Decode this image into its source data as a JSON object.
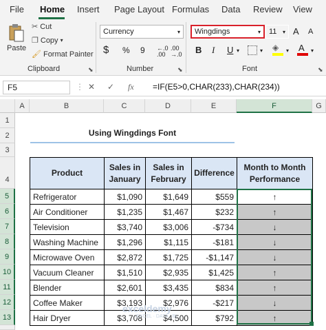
{
  "ribbon_tabs": [
    "File",
    "Home",
    "Insert",
    "Page Layout",
    "Formulas",
    "Data",
    "Review",
    "View"
  ],
  "clipboard": {
    "paste": "Paste",
    "cut": "Cut",
    "copy": "Copy",
    "format_painter": "Format Painter",
    "label": "Clipboard"
  },
  "number": {
    "format": "Currency",
    "currency_symbol": "$",
    "percent": "%",
    "comma": "9",
    "inc_decimal": "←.0 .00",
    "dec_decimal": ".00 →.0",
    "label": "Number"
  },
  "font": {
    "name": "Wingdings",
    "size": "11",
    "grow": "A",
    "shrink": "A",
    "bold": "B",
    "italic": "I",
    "underline": "U",
    "label": "Font"
  },
  "formula_bar": {
    "name_box": "F5",
    "cancel": "✕",
    "enter": "✓",
    "fx": "fx",
    "formula": "=IF(E5>0,CHAR(233),CHAR(234))"
  },
  "columns": [
    "A",
    "B",
    "C",
    "D",
    "E",
    "F",
    "G"
  ],
  "rows": [
    "1",
    "2",
    "3",
    "4",
    "5",
    "6",
    "7",
    "8",
    "9",
    "10",
    "11",
    "12",
    "13"
  ],
  "sheet": {
    "title": "Using Wingdings Font",
    "headers": [
      "Product",
      "Sales in January",
      "Sales in February",
      "Difference",
      "Month to Month Performance"
    ],
    "data": [
      {
        "product": "Refrigerator",
        "jan": "$1,090",
        "feb": "$1,649",
        "diff": "$559",
        "perf": "↑"
      },
      {
        "product": "Air Conditioner",
        "jan": "$1,235",
        "feb": "$1,467",
        "diff": "$232",
        "perf": "↑"
      },
      {
        "product": "Television",
        "jan": "$3,740",
        "feb": "$3,006",
        "diff": "-$734",
        "perf": "↓"
      },
      {
        "product": "Washing Machine",
        "jan": "$1,296",
        "feb": "$1,115",
        "diff": "-$181",
        "perf": "↓"
      },
      {
        "product": "Microwave Oven",
        "jan": "$2,872",
        "feb": "$1,725",
        "diff": "-$1,147",
        "perf": "↓"
      },
      {
        "product": "Vacuum Cleaner",
        "jan": "$1,510",
        "feb": "$2,935",
        "diff": "$1,425",
        "perf": "↑"
      },
      {
        "product": "Blender",
        "jan": "$2,601",
        "feb": "$3,435",
        "diff": "$834",
        "perf": "↑"
      },
      {
        "product": "Coffee Maker",
        "jan": "$3,193",
        "feb": "$2,976",
        "diff": "-$217",
        "perf": "↓"
      },
      {
        "product": "Hair Dryer",
        "jan": "$3,708",
        "feb": "$4,500",
        "diff": "$792",
        "perf": "↑"
      }
    ]
  },
  "watermark": {
    "brand": "exceldemy",
    "tagline": "EXCEL · DATA · BI"
  }
}
